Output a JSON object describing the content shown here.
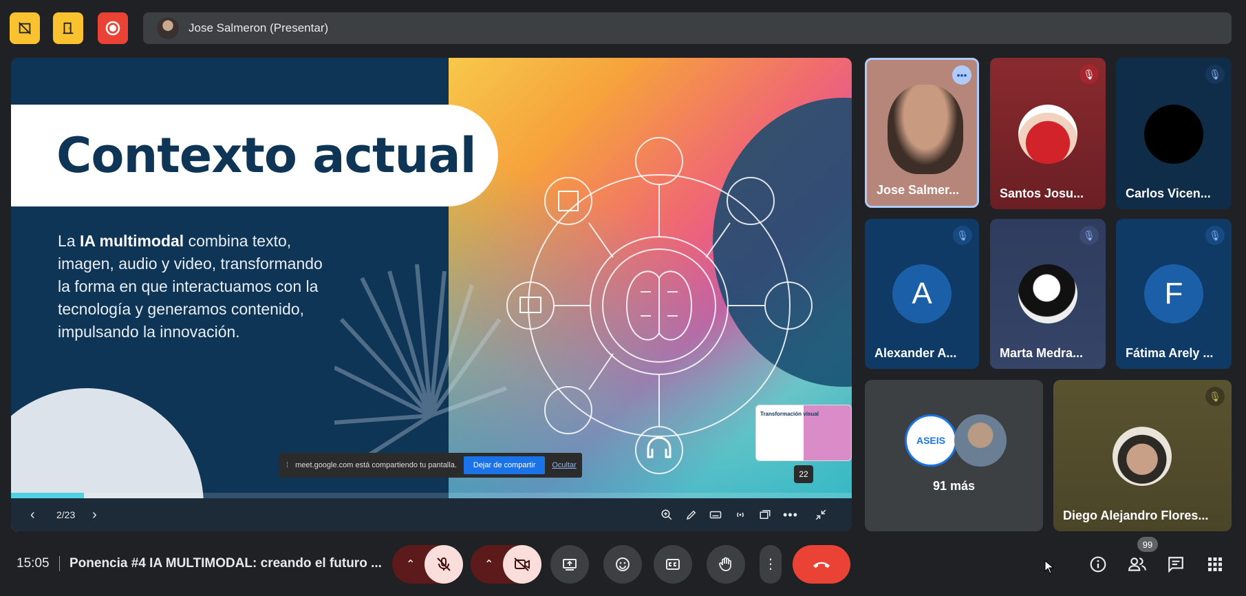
{
  "presenter_bar": {
    "label": "Jose Salmeron (Presentar)"
  },
  "slide": {
    "title": "Contexto actual",
    "body_pre": "La ",
    "body_bold": "IA multimodal",
    "body_post": " combina texto, imagen, audio y video, transformando la forma en que interactuamos con la tecnología y generamos contenido, impulsando la innovación.",
    "page_indicator": "2/23",
    "badge_count": "22",
    "progress_fraction": 0.087,
    "thumbnail_title": "Transformación visual"
  },
  "share_notice": {
    "text": "meet.google.com está compartiendo tu pantalla.",
    "stop_label": "Dejar de compartir",
    "hide_label": "Ocultar"
  },
  "participants": [
    {
      "name": "Jose Salmer...",
      "muted": false
    },
    {
      "name": "Santos Josu...",
      "muted": true
    },
    {
      "name": "Carlos Vicen...",
      "muted": true
    },
    {
      "name": "Alexander A...",
      "initial": "A",
      "muted": true
    },
    {
      "name": "Marta Medra...",
      "muted": true
    },
    {
      "name": "Fátima Arely ...",
      "initial": "F",
      "muted": true
    },
    {
      "name": "Diego Alejandro Flores...",
      "muted": true
    }
  ],
  "more_tile": {
    "label": "91 más",
    "logo_text": "ASEIS"
  },
  "bottom_bar": {
    "time": "15:05",
    "meeting_title": "Ponencia #4 IA MULTIMODAL: creando el futuro ...",
    "people_count": "99"
  },
  "colors": {
    "background": "#202124",
    "accent_yellow": "#f9c22e",
    "record_red": "#ea4335",
    "muted_bg": "#f9dedc",
    "end_call": "#ea4335"
  }
}
